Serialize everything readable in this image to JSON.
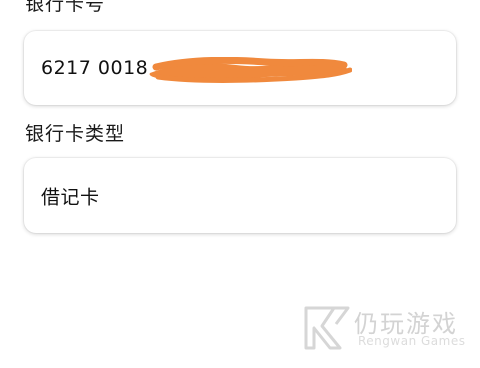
{
  "form": {
    "card_number_label": "银行卡号",
    "card_number_value": "6217 0018",
    "card_type_label": "银行卡类型",
    "card_type_value": "借记卡"
  },
  "watermark": {
    "title": "仍玩游戏",
    "subtitle": "Rengwan Games"
  },
  "colors": {
    "redaction": "#f0893d",
    "card_border": "#e0e0e0",
    "watermark": "#d3d3d3"
  }
}
